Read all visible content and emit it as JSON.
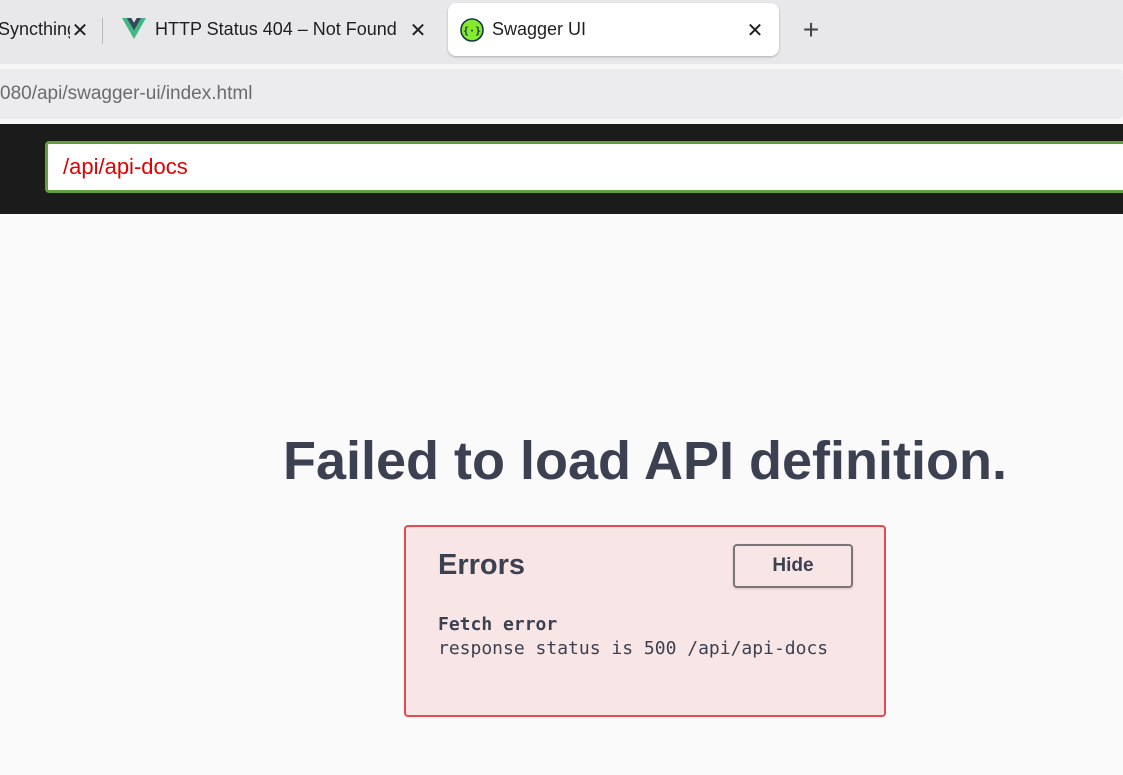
{
  "browser": {
    "tabs": [
      {
        "title": "Syncthing",
        "icon": "none",
        "active": false
      },
      {
        "title": "HTTP Status 404 – Not Found",
        "icon": "vue-logo-icon",
        "active": false
      },
      {
        "title": "Swagger UI",
        "icon": "swagger-logo-icon",
        "active": true
      }
    ],
    "close_glyph": "✕",
    "new_tab_glyph": "+",
    "url": "080/api/swagger-ui/index.html"
  },
  "topbar": {
    "spec_url_value": "/api/api-docs"
  },
  "main": {
    "title": "Failed to load API definition.",
    "errors": {
      "heading": "Errors",
      "hide_label": "Hide",
      "items": [
        {
          "type": "Fetch error",
          "message": "response status is 500 /api/api-docs"
        }
      ]
    }
  },
  "colors": {
    "topbar_bg": "#1b1b1b",
    "input_border": "#62a03f",
    "input_text": "#e00000",
    "error_border": "#e84a4f",
    "error_bg": "#f8e5e6",
    "title_text": "#3b4151"
  }
}
